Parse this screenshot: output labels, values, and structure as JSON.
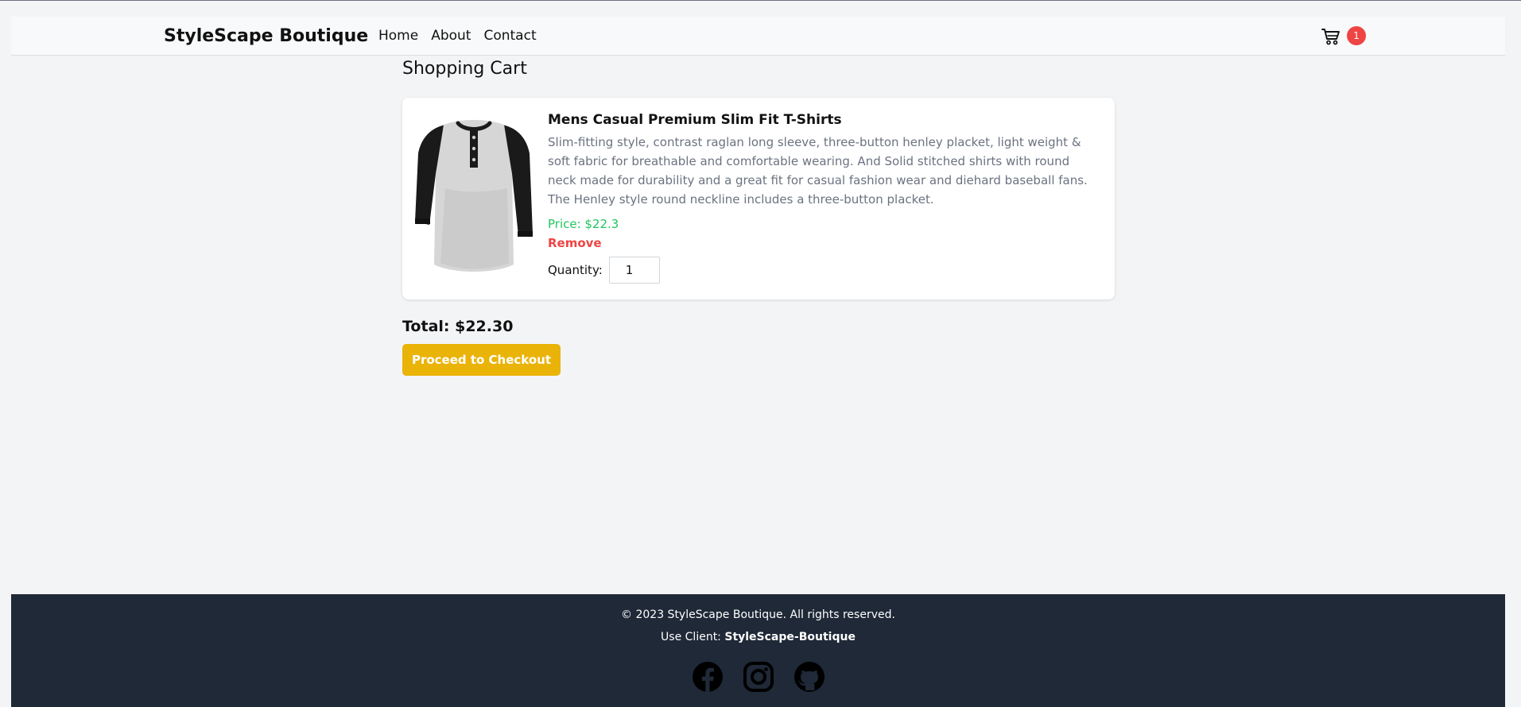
{
  "navbar": {
    "brand": "StyleScape Boutique",
    "links": [
      {
        "label": "Home"
      },
      {
        "label": "About"
      },
      {
        "label": "Contact"
      }
    ],
    "cart_icon": "shopping-cart-icon",
    "cart_count": "1"
  },
  "page": {
    "title": "Shopping Cart"
  },
  "cart": {
    "items": [
      {
        "name": "Mens Casual Premium Slim Fit T-Shirts",
        "description": "Slim-fitting style, contrast raglan long sleeve, three-button henley placket, light weight & soft fabric for breathable and comfortable wearing. And Solid stitched shirts with round neck made for durability and a great fit for casual fashion wear and diehard baseball fans. The Henley style round neckline includes a three-button placket.",
        "price_label": "Price: $22.3",
        "remove_label": "Remove",
        "quantity_label": "Quantity:",
        "quantity": "1",
        "image_icon": "raglan-henley-tshirt-image"
      }
    ],
    "total_label": "Total: $22.30",
    "checkout_label": "Proceed to Checkout"
  },
  "footer": {
    "copyright": "© 2023 StyleScape Boutique. All rights reserved.",
    "client_prefix": "Use Client: ",
    "client_name": "StyleScape-Boutique",
    "social_icons": [
      "facebook-icon",
      "instagram-icon",
      "github-icon"
    ]
  },
  "colors": {
    "background": "#f3f4f6",
    "navbar": "#f8f9fa",
    "badge": "#ef4444",
    "price": "#22c55e",
    "remove": "#ef4444",
    "checkout": "#eab308",
    "footer": "#1f2937"
  }
}
